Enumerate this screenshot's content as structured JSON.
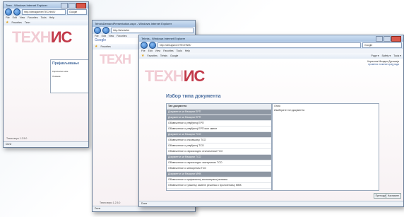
{
  "win1": {
    "title": "Техн - Windows Internet Explorer",
    "address": "http://debugsever/TECHNIS/",
    "search": "Google",
    "menu": [
      "File",
      "Edit",
      "View",
      "Favorites",
      "Tools",
      "Help"
    ],
    "fav_label": "Favorites",
    "tab_label": "Техн",
    "logo": "ТЕХН",
    "logo_accent": "ИС",
    "panel_title": "Пријављивање",
    "field1": "Корисничко име",
    "field2": "Лозинка",
    "version": "Техни верз 1.2.5.0",
    "status": "Done"
  },
  "win2": {
    "title": "TehnisDemandPresentation.aspx - Windows Internet Explorer",
    "address": "http://tehnis/tst",
    "menu": [
      "File",
      "Edit",
      "View",
      "Favorites"
    ],
    "google": "Google",
    "fav_label": "Favorites",
    "logo": "ТЕХН",
    "version": "Техни верз 1.2.5.0",
    "status": "Done"
  },
  "win3": {
    "title": "Tehnis - Windows Internet Explorer",
    "address": "http://debugsever/TECHNIS/",
    "search": "Google",
    "menu": [
      "File",
      "Edit",
      "View",
      "Favorites",
      "Tools",
      "Help"
    ],
    "fav_label": "Favorites",
    "tab_label": "Tehnis",
    "google_label": "Google",
    "toolbar_right": [
      "Page ▾",
      "Safety ▾",
      "Tools ▾"
    ],
    "user_line1": "Корисник Младен Дугошија",
    "user_line2": "промена лозинке   крај рада",
    "logo": "ТЕХН",
    "logo_accent": "ИС",
    "panel_title": "Избор типа документа",
    "list_header": "Тип документа",
    "right_header": "Опис:",
    "right_text": "Изаберите тип документа",
    "rows": [
      {
        "text": "Документи за Фазарни ЕРП",
        "group": true
      },
      {
        "text": "Документи за Фазарни ЕРП",
        "group": true
      },
      {
        "text": "Обавештење о утврђеној ЕРП",
        "group": false
      },
      {
        "text": "Обавештење о утврђеној ЕРП мон смене",
        "group": false
      },
      {
        "text": "Документи за Фазарни ТСО",
        "group": true
      },
      {
        "text": "Обавештење о отклањању ТСО",
        "group": false
      },
      {
        "text": "Обавештење о утврђеној ТСО",
        "group": false
      },
      {
        "text": "Обавештење о сврсисходно отклоњеним ТСО",
        "group": false
      },
      {
        "text": "Документи за Фазарни ТСО",
        "group": true
      },
      {
        "text": "Обавештење о сврсисходно закључених ТСО",
        "group": false
      },
      {
        "text": "Обавештење о затвореним ТСО",
        "group": false
      },
      {
        "text": "Документи за Фазарни МНК",
        "group": true
      },
      {
        "text": "Обавештење о пријављеној инсталираној активни",
        "group": false
      },
      {
        "text": "Обавештење о тражењу измене решења о пролонгнању ММК",
        "group": false
      }
    ],
    "btn_prev": "Претходни",
    "btn_next": "Наставите",
    "version": "Техни верз 1.2.5.0",
    "status": "Done"
  }
}
